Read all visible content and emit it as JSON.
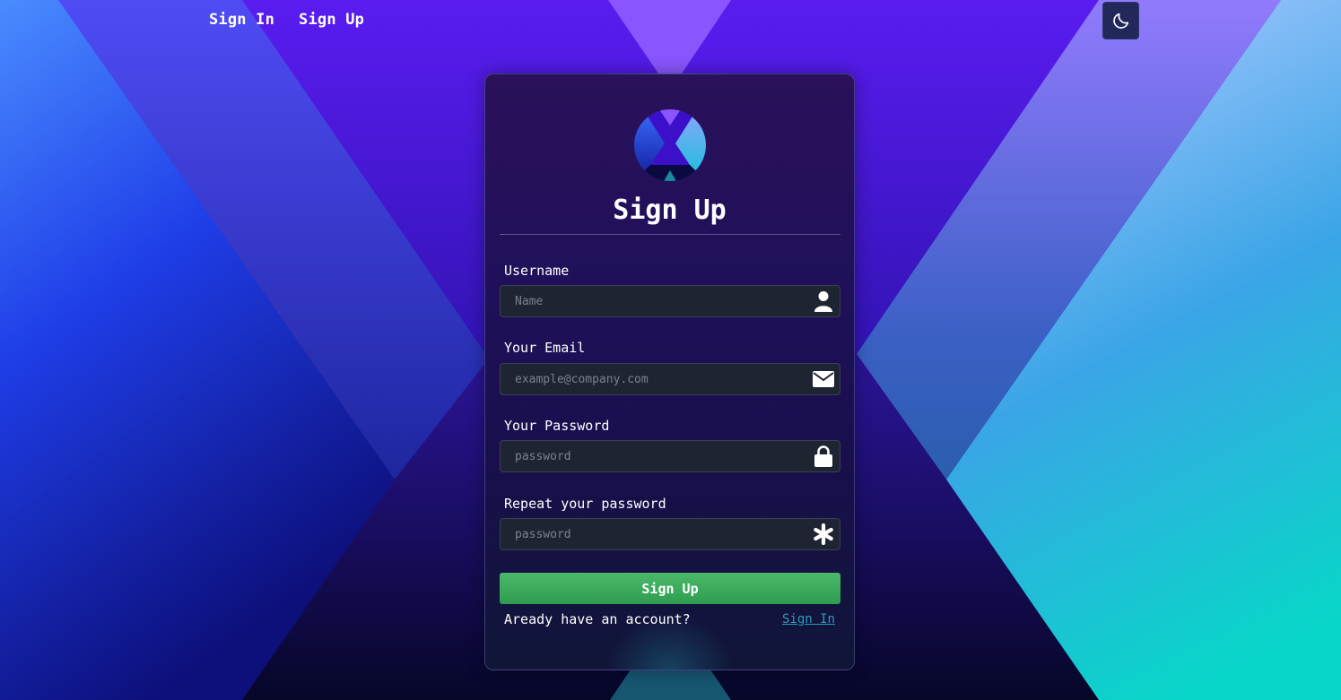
{
  "nav": {
    "sign_in": "Sign In",
    "sign_up": "Sign Up"
  },
  "theme_toggle": {
    "icon": "moon-icon"
  },
  "card": {
    "logo": "x-logo",
    "title": "Sign Up",
    "fields": [
      {
        "label": "Username",
        "placeholder": "Name",
        "icon": "user-icon"
      },
      {
        "label": "Your Email",
        "placeholder": "example@company.com",
        "icon": "envelope-icon"
      },
      {
        "label": "Your Password",
        "placeholder": "password",
        "icon": "lock-icon"
      },
      {
        "label": "Repeat your password",
        "placeholder": "password",
        "icon": "asterisk-icon"
      }
    ],
    "submit_label": "Sign Up",
    "footer_text": "Aready have an account?",
    "footer_link": "Sign In"
  },
  "colors": {
    "submit_button": "#34a853",
    "link": "#2b9bb8",
    "field_background": "#1f2432",
    "toggle_background": "#22285a"
  }
}
